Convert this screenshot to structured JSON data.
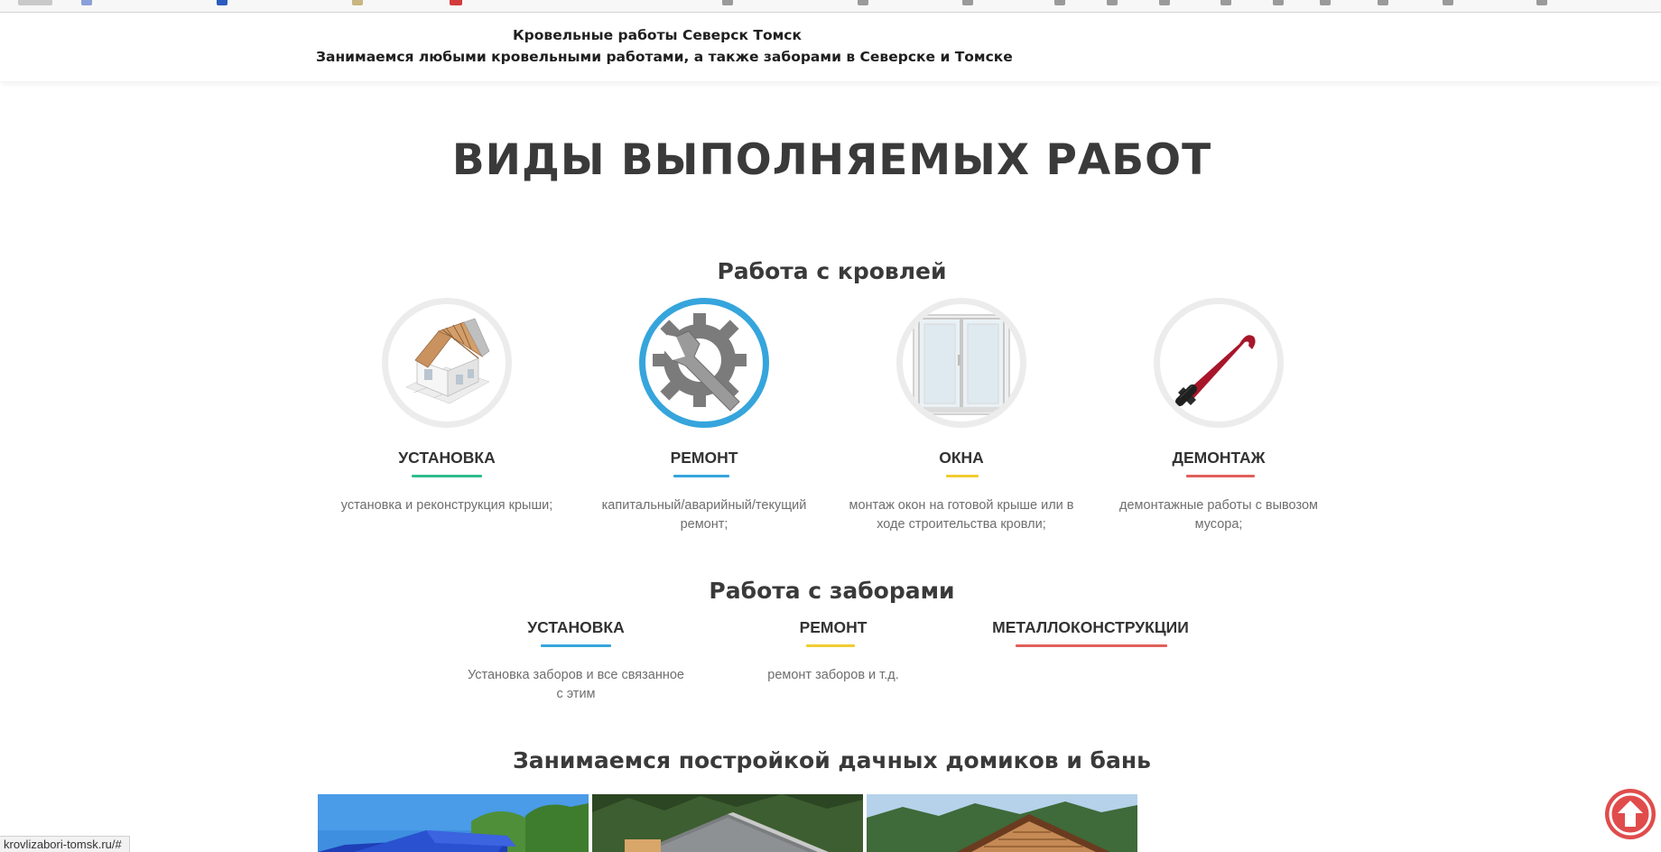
{
  "header": {
    "title": "Кровельные работы Северск Томск",
    "subtitle": "Занимаемся любыми кровельными работами, а также заборами в Северске и Томске"
  },
  "main_heading": "ВИДЫ ВЫПОЛНЯЕМЫХ РАБОТ",
  "roof_section": {
    "title": "Работа с кровлей",
    "items": [
      {
        "title": "УСТАНОВКА",
        "description": "установка и реконструкция крыши;",
        "underline_color": "#2ebd8c",
        "icon": "house-construction-icon"
      },
      {
        "title": "РЕМОНТ",
        "description": "капитальный/аварийный/текущий ремонт;",
        "underline_color": "#35a5dc",
        "icon": "wrench-gear-icon"
      },
      {
        "title": "ОКНА",
        "description": "монтаж окон на готовой крыше или в ходе строительства кровли;",
        "underline_color": "#f0cc30",
        "icon": "window-icon"
      },
      {
        "title": "ДЕМОНТАЖ",
        "description": "демонтажные работы с вывозом мусора;",
        "underline_color": "#e0605a",
        "icon": "crowbar-icon"
      }
    ]
  },
  "fence_section": {
    "title": "Работа с заборами",
    "items": [
      {
        "title": "УСТАНОВКА",
        "description": "Установка заборов и все связанное с этим",
        "underline_color": "#35a5dc"
      },
      {
        "title": "РЕМОНТ",
        "description": "ремонт заборов и т.д.",
        "underline_color": "#f0cc30"
      },
      {
        "title": "МЕТАЛЛОКОНСТРУКЦИИ",
        "description": "",
        "underline_color": "#e0605a"
      }
    ]
  },
  "cottage_section": {
    "title": "Занимаемся постройкой дачных домиков и бань"
  },
  "status_bar": {
    "url": "krovlizabori-tomsk.ru/#"
  },
  "scroll_top": {
    "icon": "arrow-up-icon",
    "color": "#e04c4c"
  }
}
